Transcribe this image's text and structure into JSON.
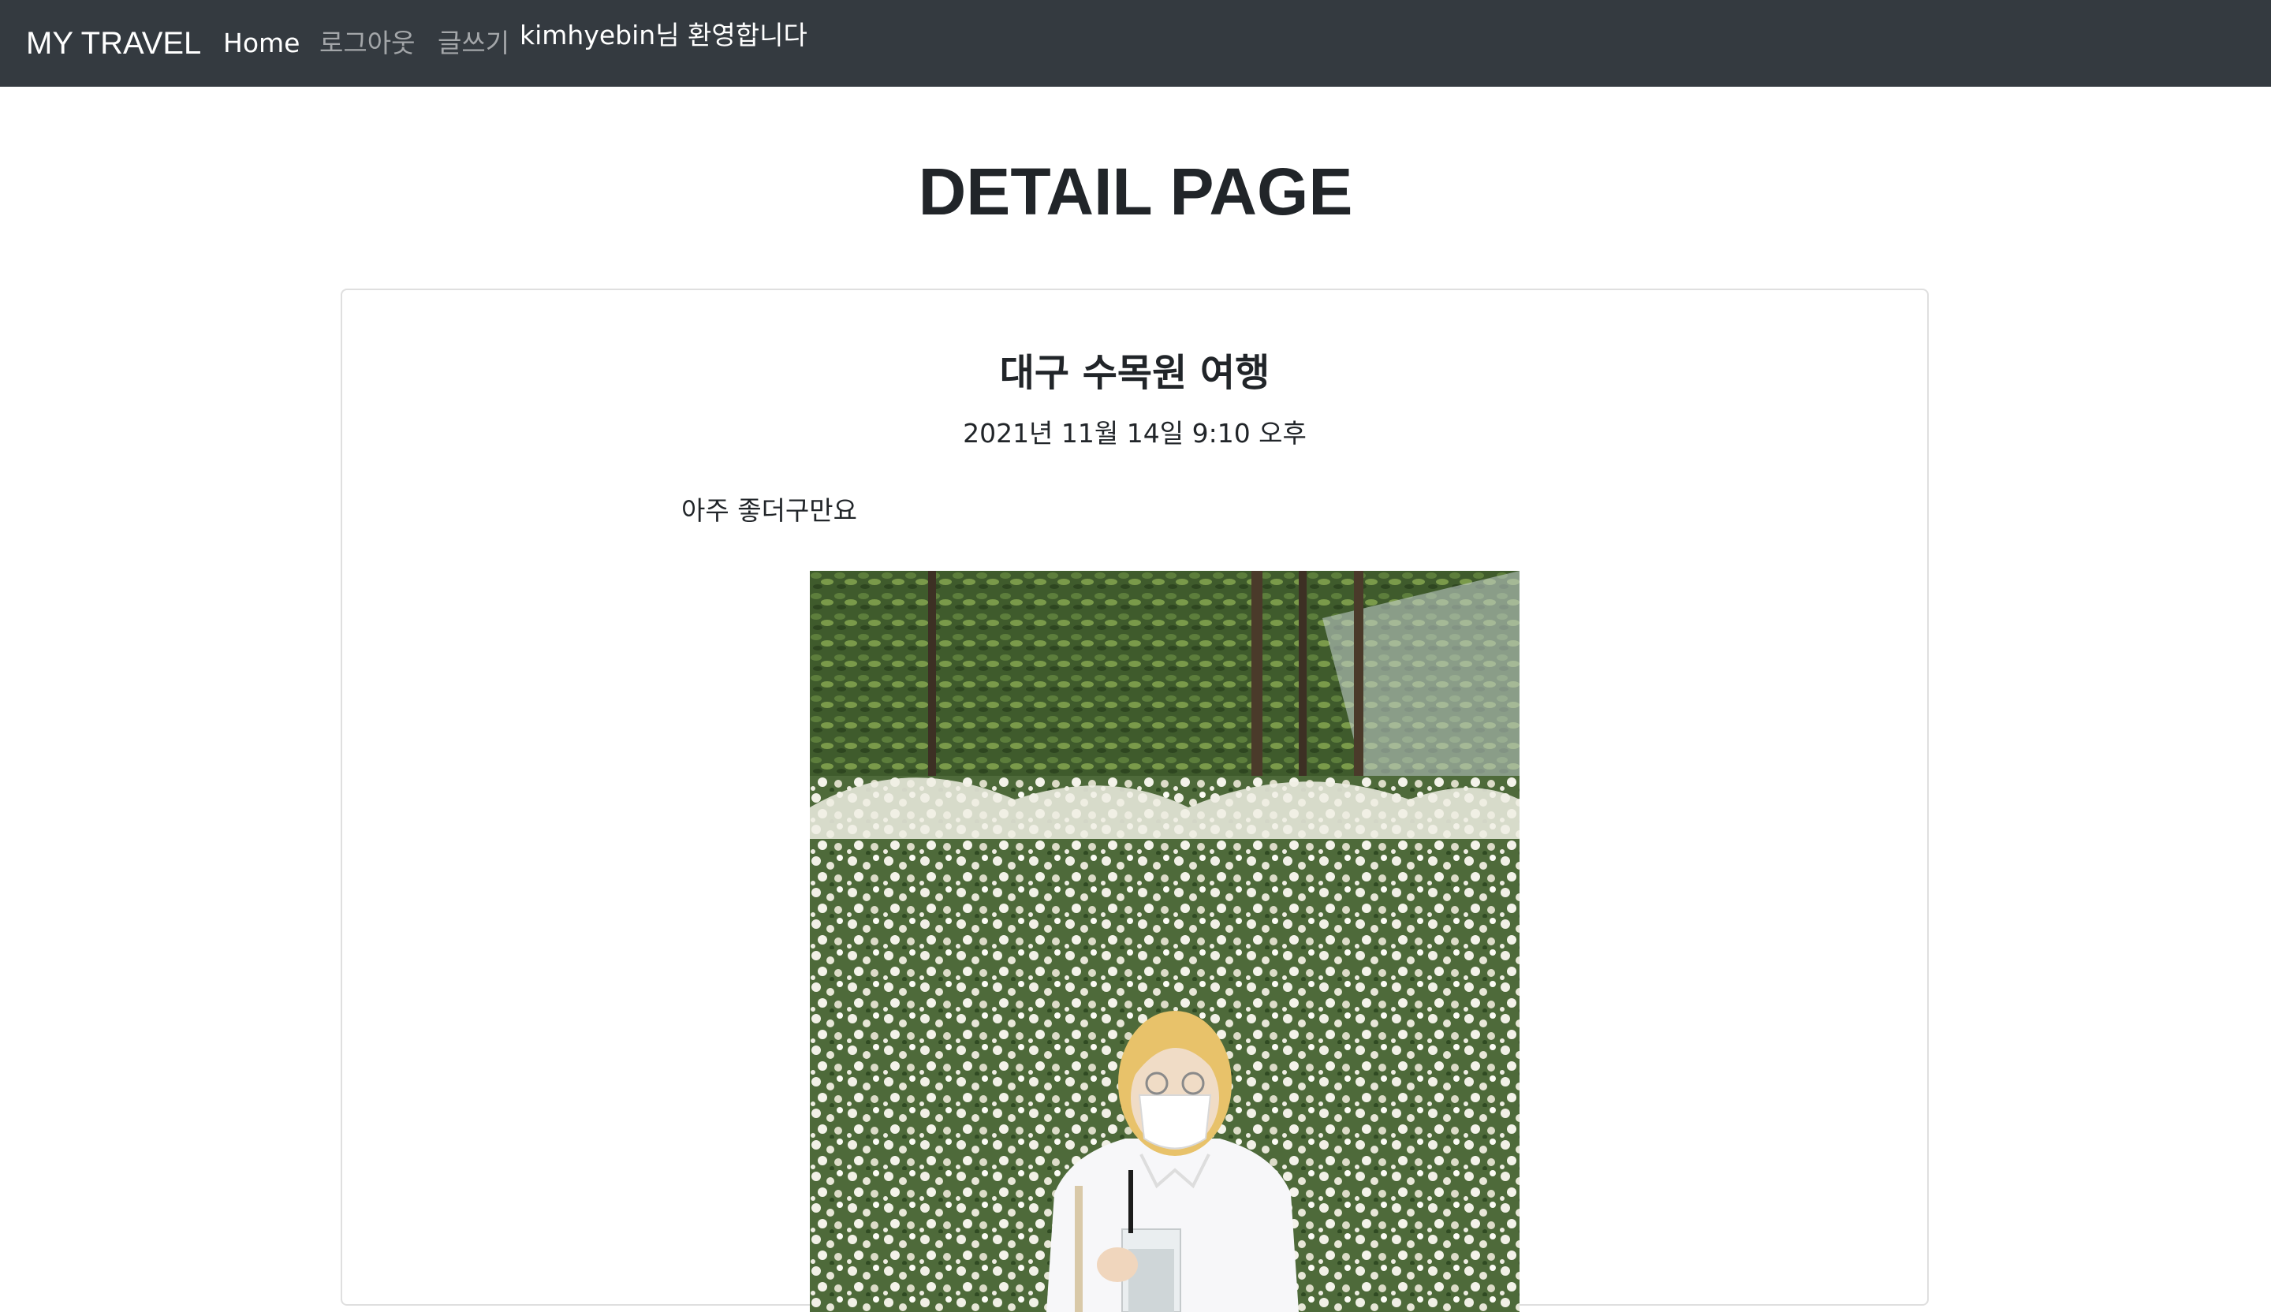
{
  "navbar": {
    "brand": "MY TRAVEL",
    "home": "Home",
    "logout": "로그아웃",
    "write": "글쓰기",
    "welcome": "kimhyebin님 환영합니다"
  },
  "page": {
    "title": "DETAIL PAGE"
  },
  "post": {
    "title": "대구 수목원 여행",
    "date": "2021년 11월 14일 9:10 오후",
    "body": "아주 좋더구만요"
  }
}
